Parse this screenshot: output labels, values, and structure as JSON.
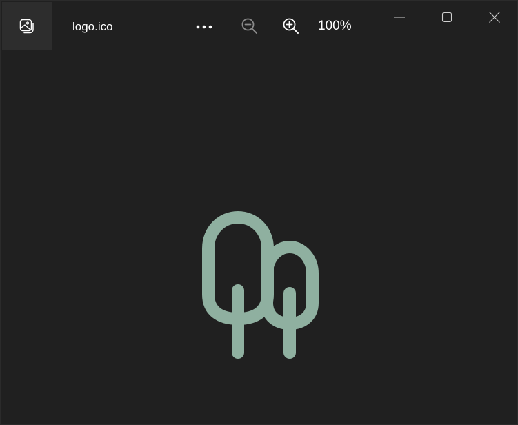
{
  "window": {
    "file_name": "logo.ico",
    "zoom_level": "100%"
  },
  "icons": {
    "app": "photo-app-icon",
    "more": "more-options-icon",
    "zoom_out": "zoom-out-icon",
    "zoom_in": "zoom-in-icon",
    "minimize": "minimize-icon",
    "maximize": "maximize-icon",
    "close": "close-icon"
  },
  "colors": {
    "background": "#202020",
    "logo": "#8fb0a0",
    "text": "#ffffff",
    "icon_disabled": "#8a8a8a"
  }
}
